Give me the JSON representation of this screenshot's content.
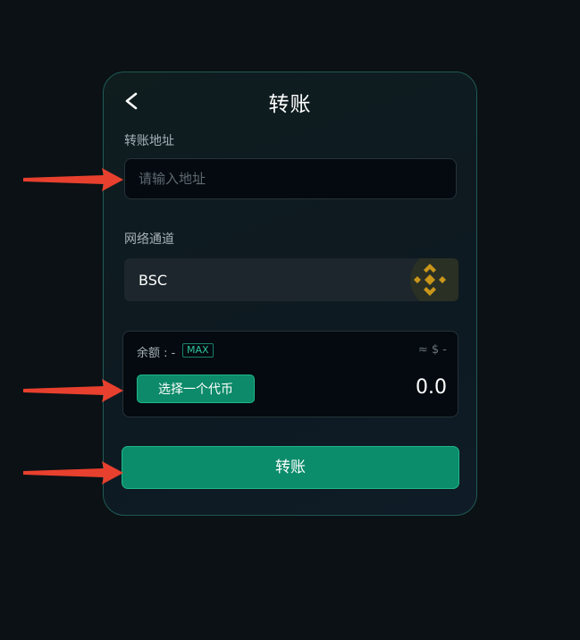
{
  "header": {
    "title": "转账",
    "back_icon": "chevron-left-icon"
  },
  "address": {
    "label": "转账地址",
    "value": "",
    "placeholder": "请输入地址"
  },
  "network": {
    "label": "网络通道",
    "selected": "BSC",
    "icon": "bnb-chain-icon"
  },
  "balance": {
    "label": "余额 : -",
    "max_label": "MAX",
    "usd_estimate": "≈ $ -",
    "select_token_label": "选择一个代币",
    "amount": "0.0"
  },
  "actions": {
    "submit_label": "转账"
  },
  "colors": {
    "accent": "#0b8c6b",
    "arrow": "#e8402e",
    "bnb": "#c9961a"
  }
}
